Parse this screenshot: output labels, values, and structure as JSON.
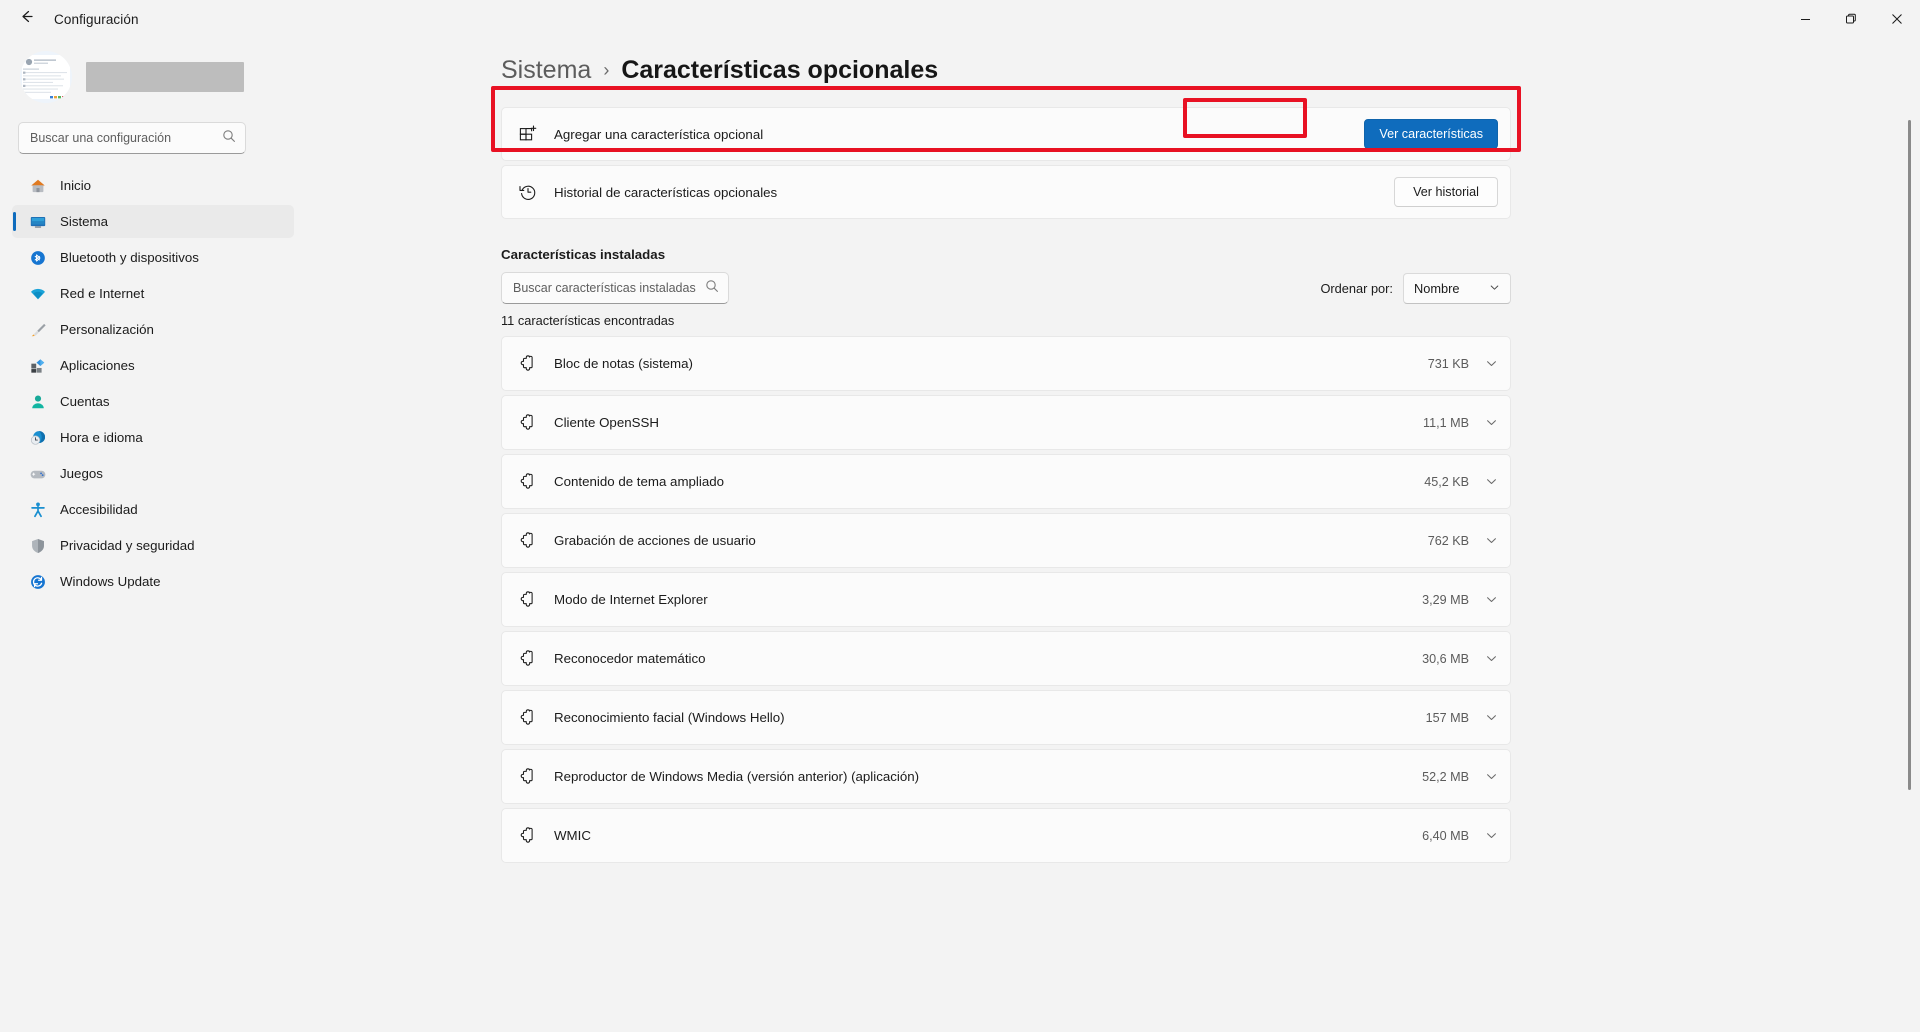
{
  "window": {
    "title": "Configuración",
    "back_icon": "arrow-left-icon",
    "controls": {
      "minimize": "minimize-icon",
      "maximize": "maximize-icon",
      "close": "close-icon"
    }
  },
  "sidebar": {
    "account_name_redacted": "",
    "search": {
      "placeholder": "Buscar una configuración",
      "value": "",
      "icon": "search-icon"
    },
    "items": [
      {
        "label": "Inicio",
        "icon": "home-icon",
        "selected": false
      },
      {
        "label": "Sistema",
        "icon": "monitor-icon",
        "selected": true
      },
      {
        "label": "Bluetooth y dispositivos",
        "icon": "bluetooth-icon",
        "selected": false
      },
      {
        "label": "Red e Internet",
        "icon": "wifi-icon",
        "selected": false
      },
      {
        "label": "Personalización",
        "icon": "paintbrush-icon",
        "selected": false
      },
      {
        "label": "Aplicaciones",
        "icon": "apps-icon",
        "selected": false
      },
      {
        "label": "Cuentas",
        "icon": "person-icon",
        "selected": false
      },
      {
        "label": "Hora e idioma",
        "icon": "clock-globe-icon",
        "selected": false
      },
      {
        "label": "Juegos",
        "icon": "gamepad-icon",
        "selected": false
      },
      {
        "label": "Accesibilidad",
        "icon": "accessibility-icon",
        "selected": false
      },
      {
        "label": "Privacidad y seguridad",
        "icon": "shield-icon",
        "selected": false
      },
      {
        "label": "Windows Update",
        "icon": "update-icon",
        "selected": false
      }
    ]
  },
  "breadcrumb": {
    "parent": "Sistema",
    "separator": "›",
    "current": "Características opcionales"
  },
  "actions": [
    {
      "icon": "add-feature-icon",
      "label": "Agregar una característica opcional",
      "button": "Ver características",
      "button_style": "accent",
      "highlighted": true
    },
    {
      "icon": "history-icon",
      "label": "Historial de características opcionales",
      "button": "Ver historial",
      "button_style": "standard",
      "highlighted": false
    }
  ],
  "installed": {
    "section_title": "Características instaladas",
    "search": {
      "placeholder": "Buscar características instaladas",
      "value": "",
      "icon": "search-icon"
    },
    "sort": {
      "label": "Ordenar por:",
      "value": "Nombre",
      "chevron": "chevron-down-icon"
    },
    "count_text": "11 características encontradas",
    "rows": [
      {
        "icon": "puzzle-icon",
        "name": "Bloc de notas (sistema)",
        "size": "731 KB",
        "chevron": "chevron-down-icon"
      },
      {
        "icon": "puzzle-icon",
        "name": "Cliente OpenSSH",
        "size": "11,1 MB",
        "chevron": "chevron-down-icon"
      },
      {
        "icon": "puzzle-icon",
        "name": "Contenido de tema ampliado",
        "size": "45,2 KB",
        "chevron": "chevron-down-icon"
      },
      {
        "icon": "puzzle-icon",
        "name": "Grabación de acciones de usuario",
        "size": "762 KB",
        "chevron": "chevron-down-icon"
      },
      {
        "icon": "puzzle-icon",
        "name": "Modo de Internet Explorer",
        "size": "3,29 MB",
        "chevron": "chevron-down-icon"
      },
      {
        "icon": "puzzle-icon",
        "name": "Reconocedor matemático",
        "size": "30,6 MB",
        "chevron": "chevron-down-icon"
      },
      {
        "icon": "puzzle-icon",
        "name": "Reconocimiento facial (Windows Hello)",
        "size": "157 MB",
        "chevron": "chevron-down-icon"
      },
      {
        "icon": "puzzle-icon",
        "name": "Reproductor de Windows Media (versión anterior) (aplicación)",
        "size": "52,2 MB",
        "chevron": "chevron-down-icon"
      },
      {
        "icon": "puzzle-icon",
        "name": "WMIC",
        "size": "6,40 MB",
        "chevron": "chevron-down-icon"
      }
    ]
  },
  "colors": {
    "accent": "#0f6cbd",
    "annotation": "#e81123",
    "window_bg": "#f3f3f3",
    "card_bg": "#fbfbfb",
    "selected_nav": "#eaeaea"
  }
}
